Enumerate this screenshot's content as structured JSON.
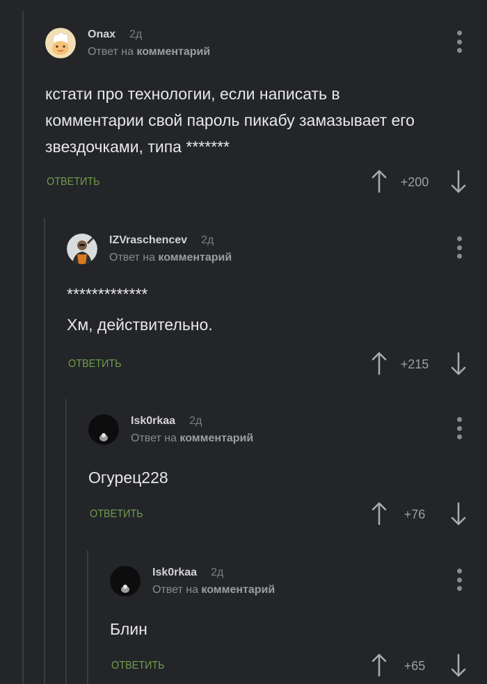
{
  "comments": [
    {
      "author": "Onax",
      "time": "2д",
      "reply_prefix": "Ответ на",
      "reply_link": "комментарий",
      "lines": [
        "кстати про технологии, если написать в",
        "комментарии свой пароль пикабу замазывает его",
        "звездочками, типа *******"
      ],
      "reply_label": "ОТВЕТИТЬ",
      "rating": "+200",
      "avatar": "chef-avatar"
    },
    {
      "author": "IZVraschencev",
      "time": "2д",
      "reply_prefix": "Ответ на",
      "reply_link": "комментарий",
      "lines": [
        "*************",
        "Хм, действительно."
      ],
      "reply_label": "ОТВЕТИТЬ",
      "rating": "+215",
      "avatar": "gordon-freeman-avatar"
    },
    {
      "author": "Isk0rkaa",
      "time": "2д",
      "reply_prefix": "Ответ на",
      "reply_link": "комментарий",
      "lines": [
        "Огурец228"
      ],
      "reply_label": "ОТВЕТИТЬ",
      "rating": "+76",
      "avatar": "dark-figure-avatar"
    },
    {
      "author": "Isk0rkaa",
      "time": "2д",
      "reply_prefix": "Ответ на",
      "reply_link": "комментарий",
      "lines": [
        "Блин"
      ],
      "reply_label": "ОТВЕТИТЬ",
      "rating": "+65",
      "avatar": "dark-figure-avatar"
    }
  ],
  "colors": {
    "background": "#232529",
    "reply_button": "#6f9c4a",
    "thread_line": "#3a3c41"
  }
}
